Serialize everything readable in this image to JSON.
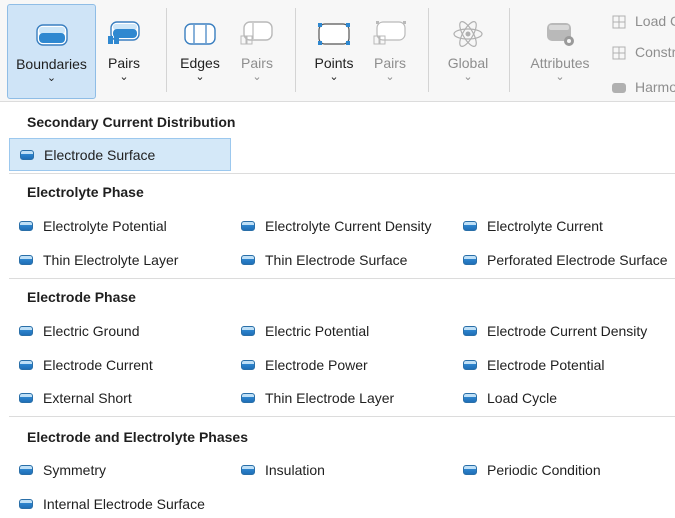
{
  "ribbon": {
    "boundaries": {
      "label": "Boundaries",
      "icon": "boundary-cylinder-icon"
    },
    "pairs1": {
      "label": "Pairs",
      "icon": "boundary-pair-icon"
    },
    "edges": {
      "label": "Edges",
      "icon": "edge-cylinder-icon"
    },
    "pairs2": {
      "label": "Pairs",
      "icon": "edge-pair-icon"
    },
    "points": {
      "label": "Points",
      "icon": "point-cylinder-icon"
    },
    "pairs3": {
      "label": "Pairs",
      "icon": "point-pair-icon"
    },
    "global": {
      "label": "Global",
      "icon": "atom-icon"
    },
    "attributes": {
      "label": "Attributes",
      "icon": "attributes-icon"
    },
    "side": {
      "load": "Load C",
      "constr": "Constr",
      "harmo": "Harmo"
    }
  },
  "menu": {
    "sections": [
      {
        "title": "Secondary Current Distribution",
        "items": [
          "Electrode Surface"
        ]
      },
      {
        "title": "Electrolyte Phase",
        "items": [
          "Electrolyte Potential",
          "Electrolyte Current Density",
          "Electrolyte Current",
          "Thin Electrolyte Layer",
          "Thin Electrode Surface",
          "Perforated Electrode Surface"
        ]
      },
      {
        "title": "Electrode Phase",
        "items": [
          "Electric Ground",
          "Electric Potential",
          "Electrode Current Density",
          "Electrode Current",
          "Electrode Power",
          "Electrode Potential",
          "External Short",
          "Thin Electrode Layer",
          "Load Cycle"
        ]
      },
      {
        "title": "Electrode and Electrolyte Phases",
        "items": [
          "Symmetry",
          "Insulation",
          "Periodic Condition",
          "Internal Electrode Surface"
        ]
      }
    ],
    "selected_item": "Electrode Surface"
  }
}
